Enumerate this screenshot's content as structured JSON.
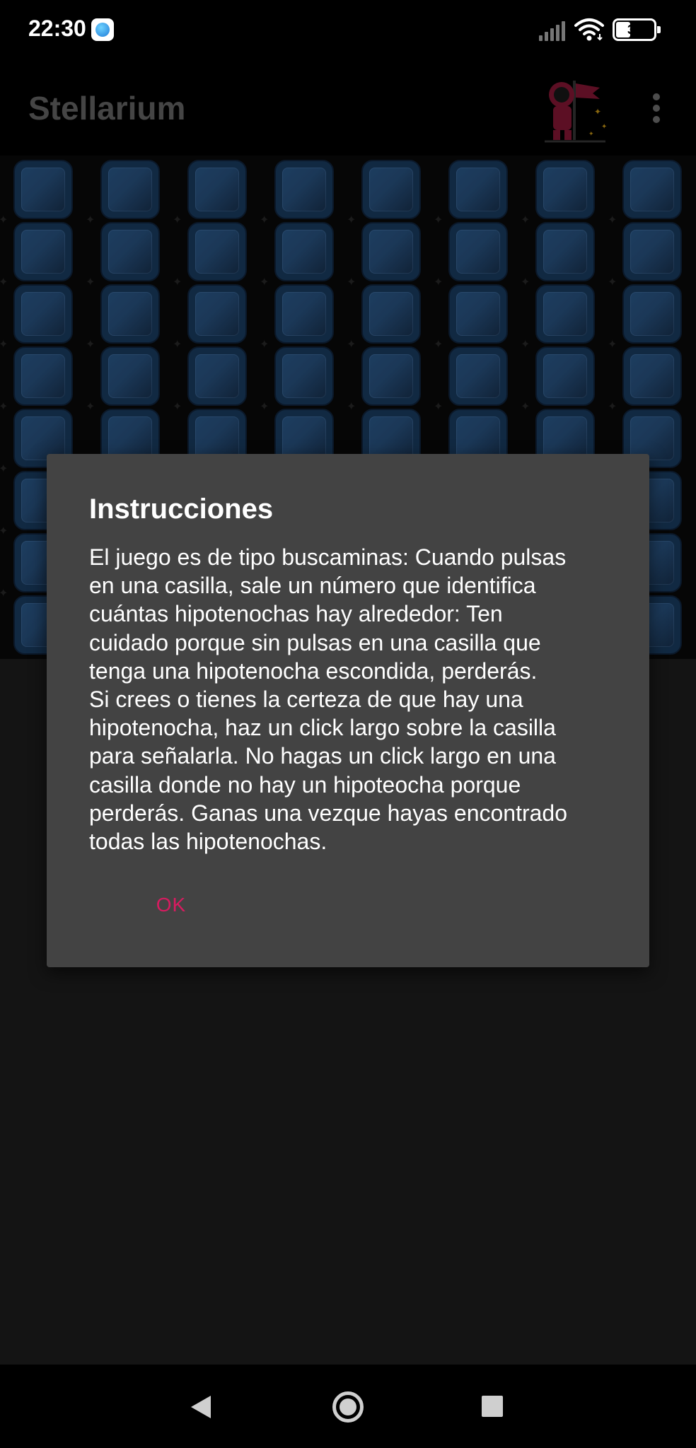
{
  "status_bar": {
    "time": "22:30",
    "battery": "33",
    "icons": [
      "app-notification-icon",
      "signal-icon",
      "wifi-icon",
      "battery-icon"
    ]
  },
  "app_bar": {
    "title": "Stellarium",
    "icons": [
      "astronaut-icon",
      "more-options-icon"
    ]
  },
  "board": {
    "columns": 8,
    "visible_rows": 8
  },
  "dialog": {
    "title": "Instrucciones",
    "body_lines": [
      "El juego es de tipo buscaminas: Cuando pulsas",
      "en una casilla, sale un número que identifica",
      "cuántas hipotenochas hay alrededor: Ten",
      "cuidado porque sin pulsas en una casilla que",
      "tenga una hipotenocha escondida, perderás.",
      "Si crees o tienes la certeza de que hay una",
      "hipotenocha, haz un click largo sobre la casilla",
      "para señalarla. No hagas un click largo en una",
      "casilla donde no hay un hipoteocha porque",
      "perderás. Ganas una vezque hayas encontrado",
      "todas las hipotenochas."
    ],
    "ok_label": "OK",
    "accent_color": "#d81b60"
  },
  "nav_bar": {
    "icons": [
      "back-icon",
      "home-icon",
      "recents-icon"
    ]
  }
}
